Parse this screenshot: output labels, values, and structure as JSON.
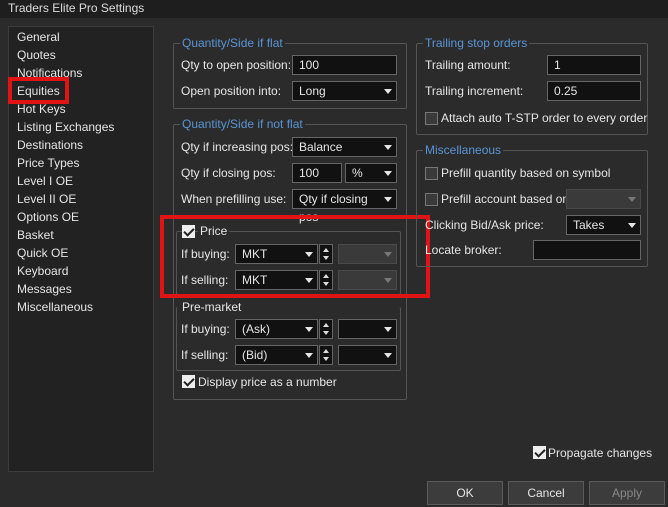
{
  "window": {
    "title": "Traders Elite Pro Settings"
  },
  "sidebar": {
    "items": [
      {
        "label": "General"
      },
      {
        "label": "Quotes"
      },
      {
        "label": "Notifications"
      },
      {
        "label": "Equities"
      },
      {
        "label": "Hot Keys"
      },
      {
        "label": "Listing Exchanges"
      },
      {
        "label": "Destinations"
      },
      {
        "label": "Price Types"
      },
      {
        "label": "Level I OE"
      },
      {
        "label": "Level II OE"
      },
      {
        "label": "Options OE"
      },
      {
        "label": "Basket"
      },
      {
        "label": "Quick OE"
      },
      {
        "label": "Keyboard"
      },
      {
        "label": "Messages"
      },
      {
        "label": "Miscellaneous"
      }
    ],
    "selected": "Equities"
  },
  "qty_flat": {
    "legend": "Quantity/Side if flat",
    "qty_label": "Qty to open position:",
    "qty_value": "100",
    "open_label": "Open position into:",
    "open_value": "Long"
  },
  "qty_not_flat": {
    "legend": "Quantity/Side if not flat",
    "increasing_label": "Qty if increasing pos:",
    "increasing_value": "Balance",
    "closing_label": "Qty if closing pos:",
    "closing_value": "100",
    "closing_unit": "%",
    "prefill_label": "When prefilling use:",
    "prefill_value": "Qty if closing pos"
  },
  "price": {
    "label": "Price",
    "checked": true,
    "buying_label": "If buying:",
    "buying_value": "MKT",
    "selling_label": "If selling:",
    "selling_value": "MKT"
  },
  "premarket": {
    "label": "Pre-market",
    "buying_label": "If buying:",
    "buying_value": "(Ask)",
    "selling_label": "If selling:",
    "selling_value": "(Bid)",
    "display_label": "Display price as a number",
    "display_checked": true
  },
  "trailing": {
    "legend": "Trailing stop orders",
    "amount_label": "Trailing amount:",
    "amount_value": "1",
    "increment_label": "Trailing increment:",
    "increment_value": "0.25",
    "attach_label": "Attach auto T-STP order to every order",
    "attach_checked": false
  },
  "misc": {
    "legend": "Miscellaneous",
    "prefill_qty_label": "Prefill quantity based on symbol",
    "prefill_account_label": "Prefill account based on",
    "clicking_label": "Clicking Bid/Ask price:",
    "clicking_value": "Takes",
    "locate_label": "Locate broker:",
    "locate_value": ""
  },
  "footer": {
    "propagate_label": "Propagate changes",
    "propagate_checked": true,
    "ok_label": "OK",
    "cancel_label": "Cancel",
    "apply_label": "Apply"
  },
  "colors": {
    "accent": "#5a95d6",
    "highlight": "#e01414",
    "background": "#2b2b2b"
  }
}
